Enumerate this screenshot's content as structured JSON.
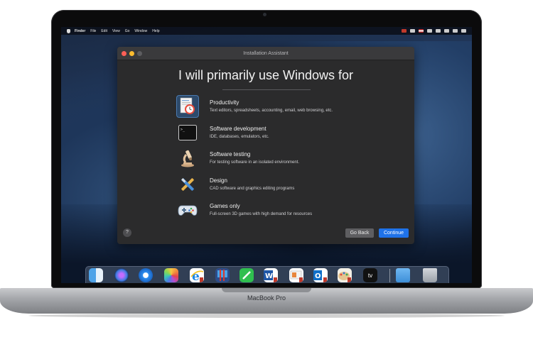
{
  "menubar": {
    "app": "Finder",
    "items": [
      "File",
      "Edit",
      "View",
      "Go",
      "Window",
      "Help"
    ]
  },
  "window": {
    "title": "Installation Assistant",
    "heading": "I will primarily use Windows for",
    "options": [
      {
        "title": "Productivity",
        "desc": "Text editors, spreadsheets, accounting, email, web browsing, etc.",
        "icon": "productivity-icon",
        "selected": true
      },
      {
        "title": "Software development",
        "desc": "IDE, databases, emulators, etc.",
        "icon": "terminal-icon",
        "selected": false
      },
      {
        "title": "Software testing",
        "desc": "For testing software in an isolated environment.",
        "icon": "microscope-icon",
        "selected": false
      },
      {
        "title": "Design",
        "desc": "CAD software and graphics editing programs",
        "icon": "design-tools-icon",
        "selected": false
      },
      {
        "title": "Games only",
        "desc": "Full-screen 3D games with high demand for resources",
        "icon": "gamepad-icon",
        "selected": false
      }
    ],
    "help_label": "?",
    "back_label": "Go Back",
    "continue_label": "Continue"
  },
  "dock": {
    "apps": [
      "finder",
      "siri",
      "safari",
      "photos",
      "internet-explorer",
      "parallels",
      "evernote",
      "word",
      "powerpoint",
      "outlook",
      "paint",
      "apple-tv",
      "downloads-folder",
      "trash"
    ],
    "appletv_label": "tv"
  },
  "laptop": {
    "brand": "MacBook Pro"
  },
  "colors": {
    "accent": "#1f72e8",
    "window_bg": "#2b2b2c"
  }
}
